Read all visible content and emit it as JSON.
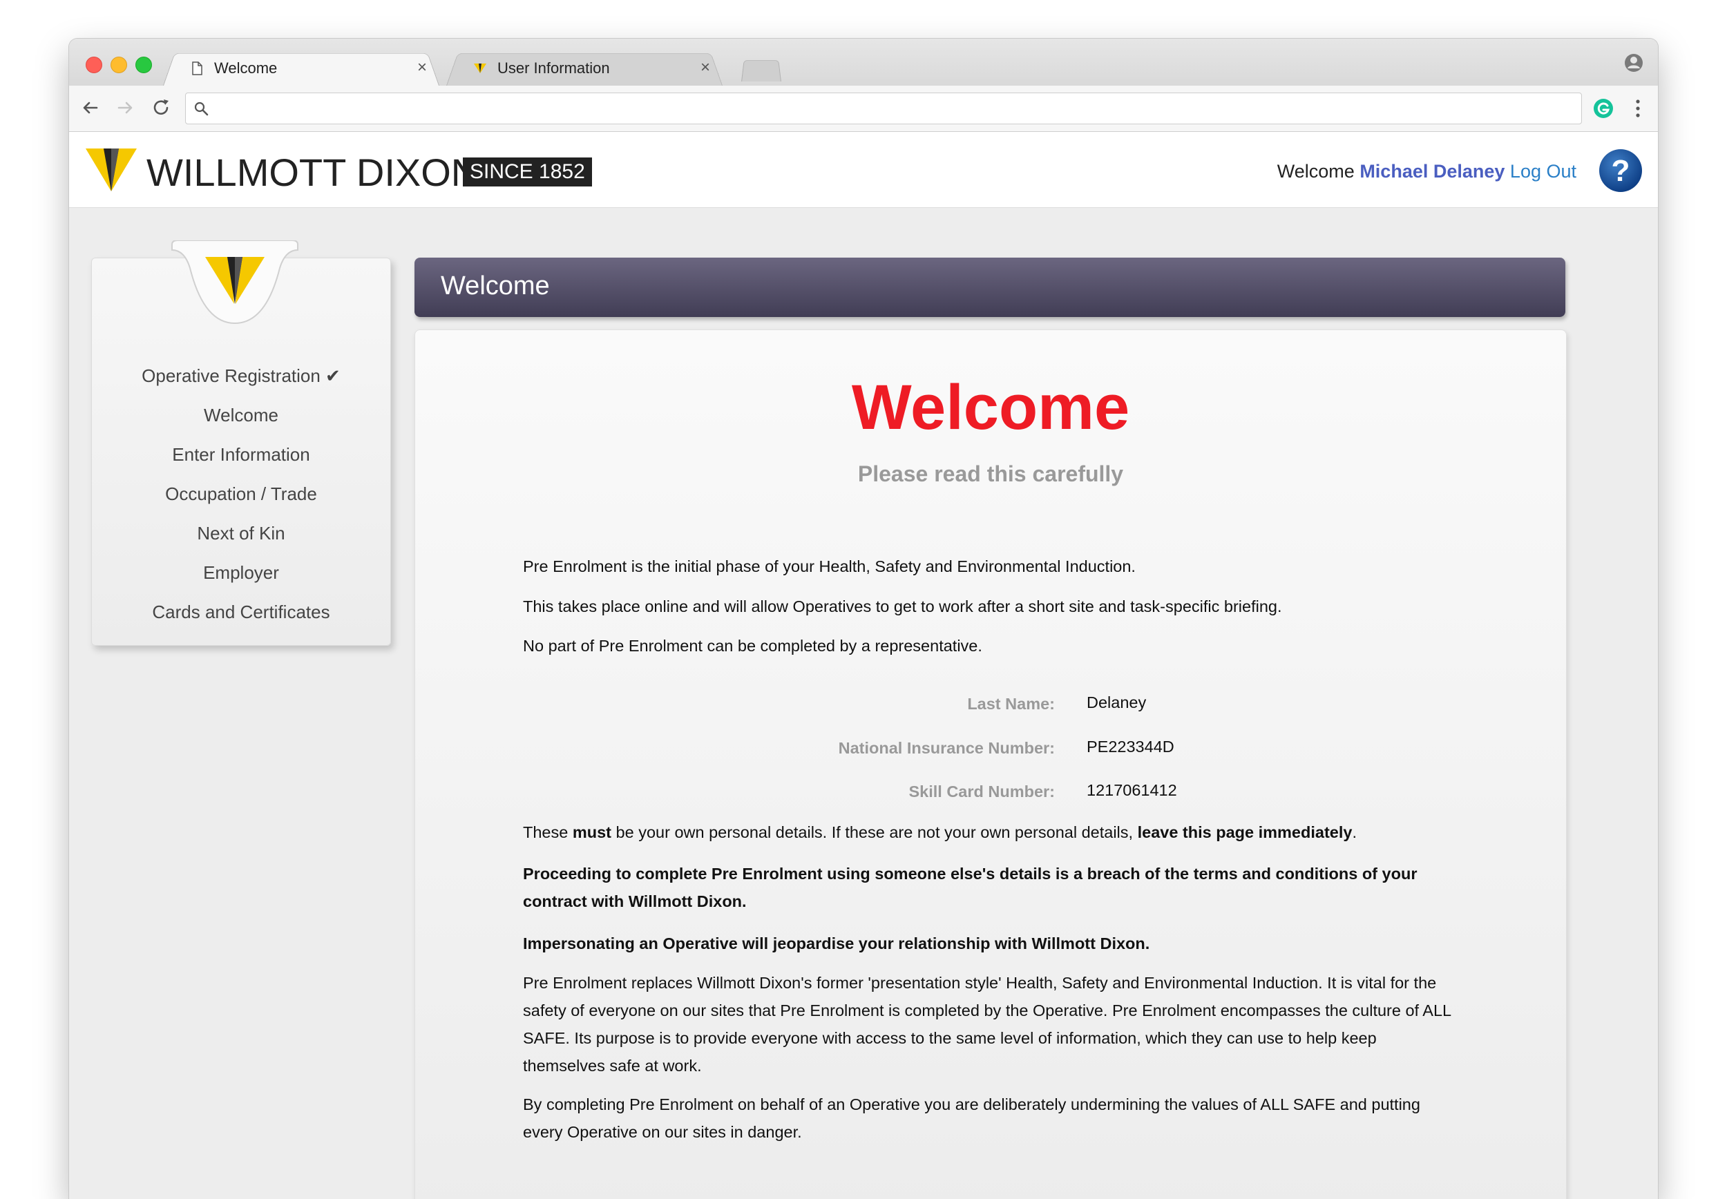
{
  "browser": {
    "tabs": [
      {
        "title": "Welcome",
        "close": "×"
      },
      {
        "title": "User Information",
        "close": "×"
      }
    ],
    "address": "",
    "address_placeholder": ""
  },
  "header": {
    "brand_name": "WILLMOTT DIXON",
    "since": "SINCE 1852",
    "welcome_label": "Welcome",
    "user_name": "Michael Delaney",
    "logout_label": "Log Out",
    "help_icon": "?"
  },
  "sidebar": {
    "items": [
      "Operative Registration ✔",
      "Welcome",
      "Enter Information",
      "Occupation / Trade",
      "Next of Kin",
      "Employer",
      "Cards and Certificates"
    ]
  },
  "main": {
    "banner_title": "Welcome",
    "heading": "Welcome",
    "subheading": "Please read this carefully",
    "intro": [
      "Pre Enrolment is the initial phase of your Health, Safety and Environmental Induction.",
      "This takes place online and will allow Operatives to get to work after a short site and task-specific briefing.",
      "No part of Pre Enrolment can be completed by a representative."
    ],
    "details": [
      {
        "label": "Last Name:",
        "value": "Delaney"
      },
      {
        "label": "National Insurance Number:",
        "value": "PE223344D"
      },
      {
        "label": "Skill Card Number:",
        "value": "1217061412"
      }
    ],
    "warning": {
      "part1": "These ",
      "must": "must",
      "part2": " be your own personal details. If these are not your own personal details, ",
      "leave": "leave this page immediately",
      "part3": "."
    },
    "breach": "Proceeding to complete Pre Enrolment using someone else's details is a breach of the terms and conditions of your contract with Willmott Dixon.",
    "impersonating": "Impersonating an Operative will jeopardise your relationship with Willmott Dixon.",
    "replaces": "Pre Enrolment replaces Willmott Dixon's former 'presentation style' Health, Safety and Environmental Induction. It is vital for the safety of everyone on our sites that Pre Enrolment is completed by the Operative. Pre Enrolment encompasses the culture of ALL SAFE. Its purpose is to provide everyone with access to the same level of information, which they can use to help keep themselves safe at work.",
    "completing": "By completing Pre Enrolment on behalf of an Operative you are deliberately undermining the values of ALL SAFE and putting every Operative on our sites in danger."
  },
  "colors": {
    "heading_red": "#ee1c25",
    "user_name_blue": "#4a5ec0",
    "logout_blue": "#2a7fc7",
    "banner_purple": "#4f4a63",
    "brand_yellow": "#f5c800"
  },
  "icons": {
    "tab1": "page-icon",
    "tab2": "willmott-dixon-favicon",
    "back": "back-arrow-icon",
    "forward": "forward-arrow-icon",
    "reload": "reload-icon",
    "search": "search-icon",
    "extension": "grammarly-icon",
    "menu": "kebab-menu-icon",
    "profile": "profile-icon",
    "help": "help-icon"
  }
}
